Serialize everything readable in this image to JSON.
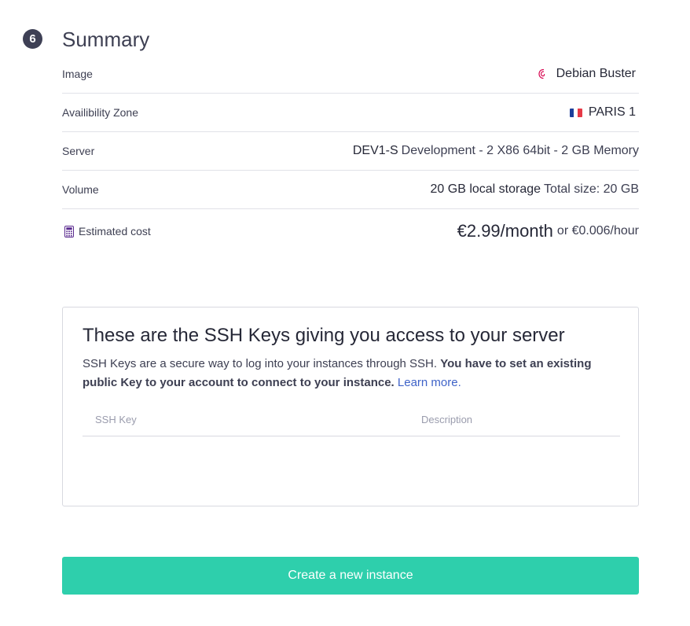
{
  "summary": {
    "step_number": "6",
    "title": "Summary",
    "rows": {
      "image": {
        "label": "Image",
        "value": "Debian Buster",
        "icon": "debian-icon"
      },
      "zone": {
        "label": "Availibility Zone",
        "value": "PARIS 1",
        "icon": "france-flag-icon",
        "flag_colors": [
          "#1d3f9a",
          "#ffffff",
          "#e63946"
        ]
      },
      "server": {
        "label": "Server",
        "value_strong": "DEV1-S",
        "value_rest": "Development - 2 X86 64bit - 2 GB Memory"
      },
      "volume": {
        "label": "Volume",
        "value_strong": "20 GB local storage",
        "value_rest": "Total size: 20 GB"
      },
      "cost": {
        "label": "Estimated cost",
        "icon": "calculator-icon",
        "price_main": "€2.99/month",
        "price_secondary": "or €0.006/hour"
      }
    }
  },
  "ssh": {
    "title": "These are the SSH Keys giving you access to your server",
    "desc_plain": "SSH Keys are a secure way to log into your instances through SSH.",
    "desc_bold": "You have to set an existing public Key to your account to connect to your instance.",
    "learn_more": "Learn more.",
    "columns": {
      "key": "SSH Key",
      "description": "Description"
    }
  },
  "actions": {
    "create_label": "Create a new instance"
  },
  "colors": {
    "accent": "#2ecfac",
    "link": "#3f63c8",
    "text": "#3d3f52",
    "calculator": "#5a2a8f",
    "debian": "#d70751"
  }
}
